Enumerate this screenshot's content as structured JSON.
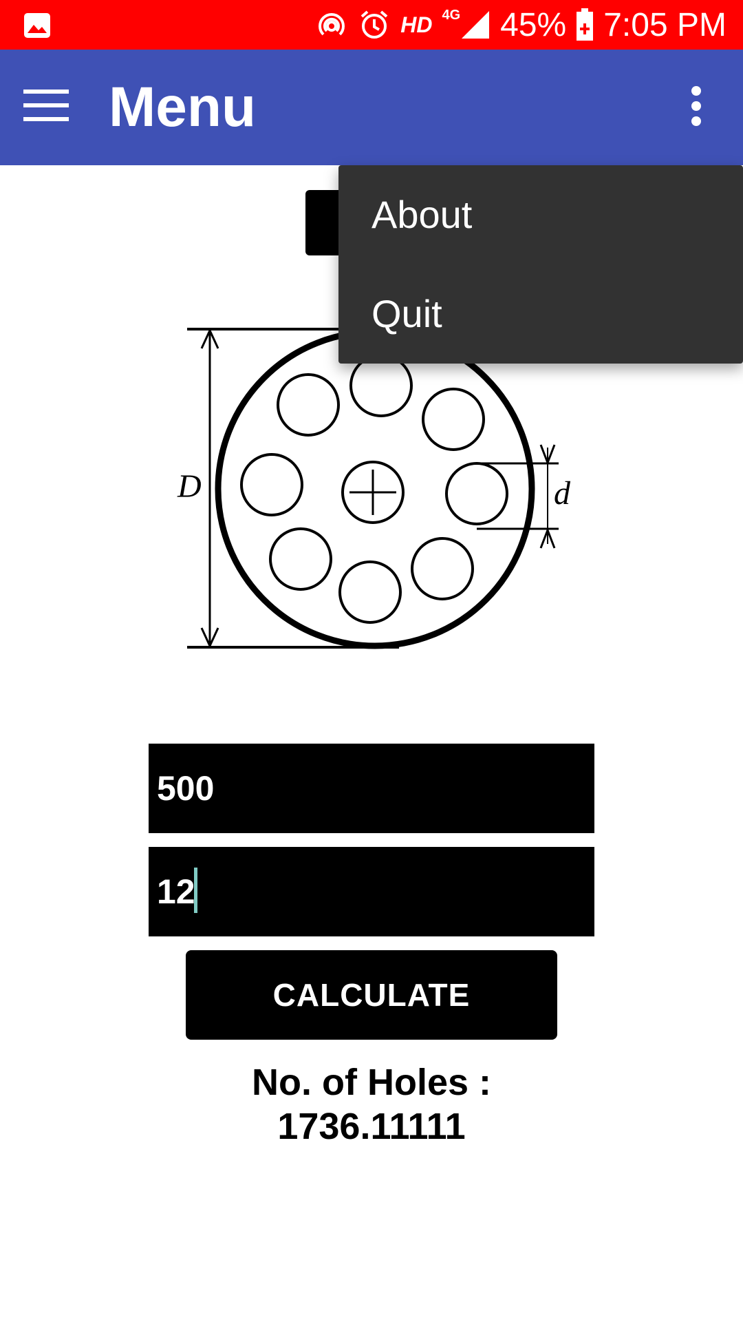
{
  "status_bar": {
    "hd_label": "HD",
    "network_label": "4G",
    "battery_percent": "45%",
    "time": "7:05 PM",
    "background_color": "#ff0000",
    "icons": [
      "gallery-icon",
      "hotspot-icon",
      "alarm-icon",
      "signal-icon",
      "battery-icon"
    ]
  },
  "app_bar": {
    "title": "Menu",
    "background_color": "#3f51b5",
    "icons": [
      "menu-icon",
      "overflow-icon"
    ]
  },
  "diagram": {
    "label_diameter": "D",
    "label_hole": "d"
  },
  "form": {
    "diameter_value": "500",
    "hole_value": "12",
    "calculate_label": "CALCULATE"
  },
  "result": {
    "label": "No. of Holes :",
    "value": "1736.11111"
  },
  "overflow_menu": {
    "items": [
      {
        "label": "About"
      },
      {
        "label": "Quit"
      }
    ]
  }
}
